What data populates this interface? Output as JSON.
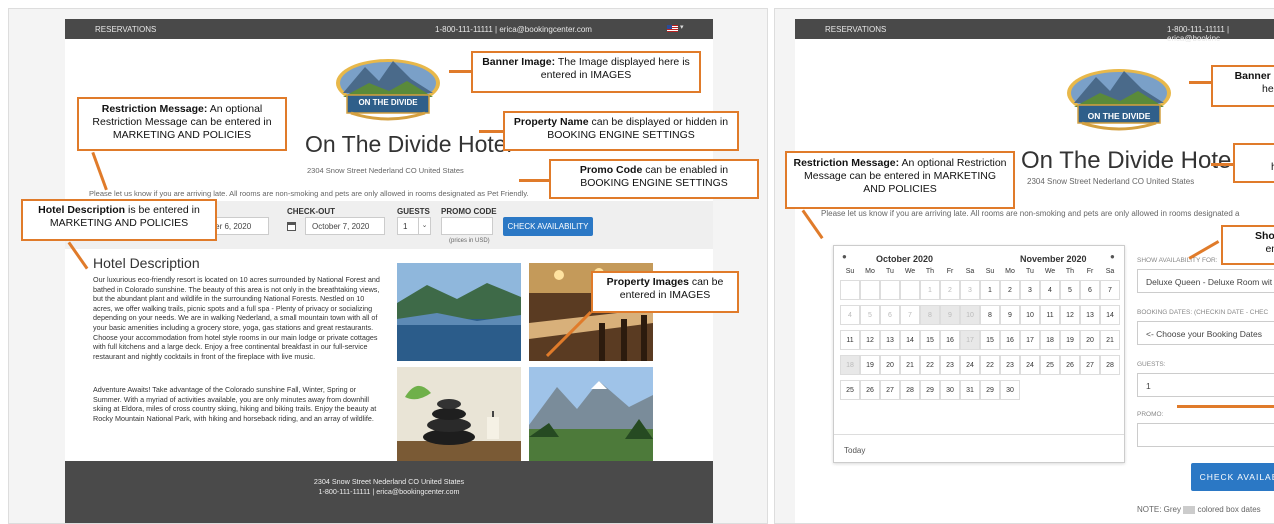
{
  "left": {
    "topbar": {
      "reservations": "RESERVATIONS",
      "contact": "1-800-111-11111 | erica@bookingcenter.com"
    },
    "logo_text": "ON THE DIVIDE",
    "hotel_name": "On The Divide Hotel",
    "address": "2304 Snow Street Nederland CO United States",
    "restriction": "Please let us know if you are arriving late. All rooms are non-smoking and pets are only allowed in rooms designated as Pet Friendly.",
    "search": {
      "checkout_label": "CHECK-OUT",
      "guests_label": "GUESTS",
      "promo_label": "PROMO CODE",
      "checkin_value": "tober 6, 2020",
      "checkout_value": "October 7, 2020",
      "guests_value": "1",
      "button": "CHECK AVAILABILITY",
      "prices_note": "(prices in USD)"
    },
    "description": {
      "title": "Hotel Description",
      "p1": "Our luxurious eco-friendly resort is located on 10 acres surrounded by National Forest and bathed in Colorado sunshine. The beauty of this area is not only in the breathtaking views, but the abundant plant and wildlife in the surrounding National Forests. Nestled on 10 acres, we offer walking trails, picnic spots and a full spa - Plenty of privacy or socializing depending on your needs. We are in walking Nederland, a small mountain town with all of your basic amenities including a grocery store, yoga, gas stations and great restaurants. Choose your accommodation from hotel style rooms in our main lodge or private cottages with full kitchens and a large deck. Enjoy a free continental breakfast in our full-service restaurant and nightly cocktails in front of the fireplace with live music.",
      "p2": "Adventure Awaits! Take advantage of the Colorado sunshine Fall, Winter, Spring or Summer. With a myriad of activities available, you are only minutes away from downhill skiing at Eldora, miles of cross country skiing, hiking and biking trails. Enjoy the beauty at Rocky Mountain National Park, with hiking and horseback riding, and an array of wildlife."
    },
    "footer": {
      "line1": "2304 Snow Street Nederland CO United States",
      "line2": "1-800-111-11111 | erica@bookingcenter.com"
    },
    "callouts": {
      "banner": {
        "bold": "Banner Image:",
        "text": " The Image displayed here is entered in IMAGES"
      },
      "restriction": {
        "bold": "Restriction Message:",
        "text": " An optional Restriction Message can be entered in MARKETING AND POLICIES"
      },
      "property_name": {
        "bold": "Property Name",
        "text": " can be displayed or hidden in BOOKING ENGINE SETTINGS"
      },
      "promo": {
        "bold": "Promo Code",
        "text": " can be enabled in BOOKING ENGINE SETTINGS"
      },
      "hotel_desc": {
        "bold": "Hotel Description",
        "text": " is be entered in MARKETING AND POLICIES"
      },
      "images": {
        "bold": "Property Images",
        "text": " can be entered in IMAGES"
      }
    }
  },
  "right": {
    "topbar": {
      "reservations": "RESERVATIONS",
      "contact": "1-800-111-11111 | erica@bookinc"
    },
    "logo_text": "ON THE DIVIDE",
    "hotel_name": "On The Divide Hotel",
    "address": "2304 Snow Street Nederland CO United States",
    "restriction": "Please let us know if you are arriving late. All rooms are non-smoking and pets are only allowed in rooms designated a",
    "calendar": {
      "oct_title": "October 2020",
      "nov_title": "November 2020",
      "dow": [
        "Su",
        "Mo",
        "Tu",
        "We",
        "Th",
        "Fr",
        "Sa"
      ],
      "oct_days": [
        "",
        "",
        "",
        "",
        "1",
        "2",
        "3",
        "4",
        "5",
        "6",
        "7",
        "8",
        "9",
        "10",
        "11",
        "12",
        "13",
        "14",
        "15",
        "16",
        "17",
        "18",
        "19",
        "20",
        "21",
        "22",
        "23",
        "24",
        "25",
        "26",
        "27",
        "28",
        "29",
        "30",
        "31"
      ],
      "nov_days": [
        "1",
        "2",
        "3",
        "4",
        "5",
        "6",
        "7",
        "8",
        "9",
        "10",
        "11",
        "12",
        "13",
        "14",
        "15",
        "16",
        "17",
        "18",
        "19",
        "20",
        "21",
        "22",
        "23",
        "24",
        "25",
        "26",
        "27",
        "28",
        "29",
        "30"
      ],
      "today": "Today"
    },
    "form": {
      "avail_label": "SHOW AVAILABILITY FOR:",
      "avail_value": "Deluxe Queen - Deluxe Room wit",
      "dates_label": "BOOKING DATES: (CHECKIN DATE - CHEC",
      "dates_value": "<- Choose your Booking Dates",
      "guests_label": "GUESTS:",
      "guests_value": "1",
      "promo_label": "PROMO:",
      "button": "CHECK AVAILAB",
      "note_prefix": "NOTE: Grey",
      "note_suffix": "colored box dates"
    },
    "callouts": {
      "banner": {
        "bold": "Banner In",
        "text": "here"
      },
      "restriction": {
        "bold": "Restriction Message:",
        "text": " An optional Restriction Message can be entered in MARKETING AND POLICIES"
      },
      "property_name": {
        "bold": "Pr",
        "text": "hid"
      },
      "show": {
        "bold": "Show",
        "text": "ena"
      }
    }
  },
  "colors": {
    "accent": "#e07b2a",
    "topbar": "#494949",
    "button": "#2b78c5"
  }
}
